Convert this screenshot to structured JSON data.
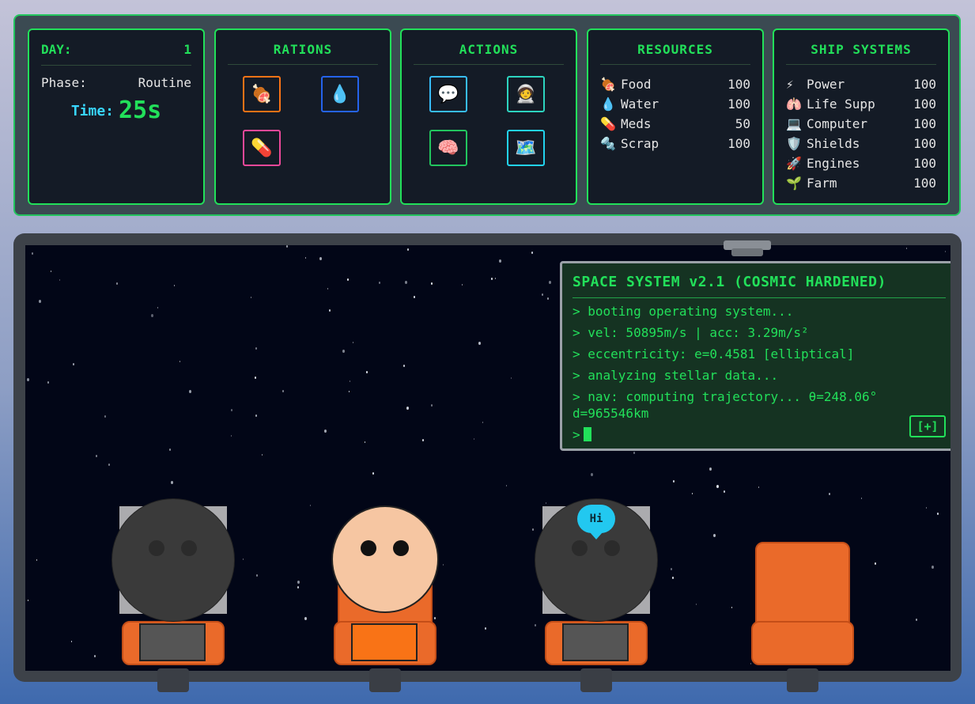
{
  "status": {
    "day_label": "DAY:",
    "day_value": "1",
    "phase_label": "Phase:",
    "phase_value": "Routine",
    "time_label": "Time:",
    "time_value": "25s"
  },
  "rations": {
    "title": "RATIONS",
    "items": [
      {
        "icon": "🍖",
        "name": "food-ration-icon",
        "color": "#f97316"
      },
      {
        "icon": "💧",
        "name": "water-ration-icon",
        "color": "#2563eb"
      },
      {
        "icon": "💊",
        "name": "meds-ration-icon",
        "color": "#ec4899"
      }
    ]
  },
  "actions": {
    "title": "ACTIONS",
    "items": [
      {
        "icon": "💬",
        "name": "talk-icon",
        "color": "#38bdf8"
      },
      {
        "icon": "🧑‍🚀",
        "name": "astronaut-icon",
        "color": "#2dd4bf"
      },
      {
        "icon": "🧠",
        "name": "brain-icon",
        "color": "#22c55e"
      },
      {
        "icon": "🗺️",
        "name": "map-icon",
        "color": "#22d3ee"
      }
    ]
  },
  "resources": {
    "title": "RESOURCES",
    "items": [
      {
        "icon": "🍖",
        "label": "Food",
        "value": "100"
      },
      {
        "icon": "💧",
        "label": "Water",
        "value": "100"
      },
      {
        "icon": "💊",
        "label": "Meds",
        "value": "50"
      },
      {
        "icon": "🔩",
        "label": "Scrap",
        "value": "100"
      }
    ]
  },
  "systems": {
    "title": "SHIP SYSTEMS",
    "items": [
      {
        "icon": "⚡",
        "label": "Power",
        "value": "100"
      },
      {
        "icon": "🫁",
        "label": "Life Supp",
        "value": "100"
      },
      {
        "icon": "💻",
        "label": "Computer",
        "value": "100"
      },
      {
        "icon": "🛡️",
        "label": "Shields",
        "value": "100"
      },
      {
        "icon": "🚀",
        "label": "Engines",
        "value": "100"
      },
      {
        "icon": "🌱",
        "label": "Farm",
        "value": "100"
      }
    ]
  },
  "terminal": {
    "title": "SPACE SYSTEM v2.1 (COSMIC HARDENED)",
    "lines": [
      "> booting operating system...",
      "> vel: 50895m/s | acc: 3.29m/s²",
      "> eccentricity: e=0.4581 [elliptical]",
      "> analyzing stellar data...",
      "> nav: computing trajectory... θ=248.06° d=965546km"
    ],
    "prompt": ">",
    "expand_label": "[+]"
  },
  "crew": {
    "speech": "Hi"
  },
  "colors": {
    "accent": "#22e05a",
    "panel_bg": "#141b26",
    "seat": "#ea6a2a",
    "terminal_bg": "#153322",
    "time_label": "#38d5ff"
  }
}
